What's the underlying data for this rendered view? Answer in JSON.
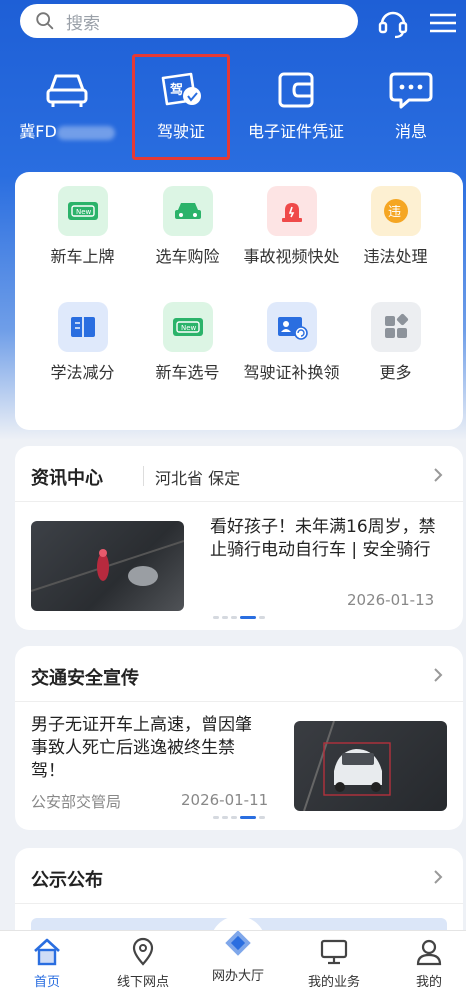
{
  "search": {
    "placeholder": "搜索"
  },
  "quick": [
    {
      "icon": "car-icon",
      "label": "冀FD"
    },
    {
      "icon": "driver-license-icon",
      "label": "驾驶证"
    },
    {
      "icon": "wallet-icon",
      "label": "电子证件凭证"
    },
    {
      "icon": "message-icon",
      "label": "消息"
    }
  ],
  "services": [
    {
      "icon": "new-plate-icon",
      "label": "新车上牌"
    },
    {
      "icon": "car-insurance-icon",
      "label": "选车购险"
    },
    {
      "icon": "alarm-icon",
      "label": "事故视频快处"
    },
    {
      "icon": "violation-icon",
      "label": "违法处理"
    },
    {
      "icon": "book-icon",
      "label": "学法减分"
    },
    {
      "icon": "new-number-icon",
      "label": "新车选号"
    },
    {
      "icon": "license-reissue-icon",
      "label": "驾驶证补换领"
    },
    {
      "icon": "more-icon",
      "label": "更多"
    }
  ],
  "news_center": {
    "title": "资讯中心",
    "region": "河北省 保定",
    "article": {
      "text": "看好孩子！未年满16周岁，禁止骑行电动自行车 | 安全骑行",
      "date": "2026-01-13"
    }
  },
  "traffic_safety": {
    "title": "交通安全宣传",
    "article": {
      "text": "男子无证开车上高速，曾因肇事致人死亡后逃逸被终生禁驾！",
      "source": "公安部交管局",
      "date": "2026-01-11"
    }
  },
  "notice": {
    "title": "公示公布"
  },
  "nav": [
    {
      "icon": "home-icon",
      "label": "首页"
    },
    {
      "icon": "location-icon",
      "label": "线下网点"
    },
    {
      "icon": "handshake-icon",
      "label": "网办大厅"
    },
    {
      "icon": "monitor-icon",
      "label": "我的业务"
    },
    {
      "icon": "user-icon",
      "label": "我的"
    }
  ],
  "colors": {
    "primary": "#2a6ee0",
    "highlight": "#e53935",
    "bg": "#eef1f6"
  }
}
